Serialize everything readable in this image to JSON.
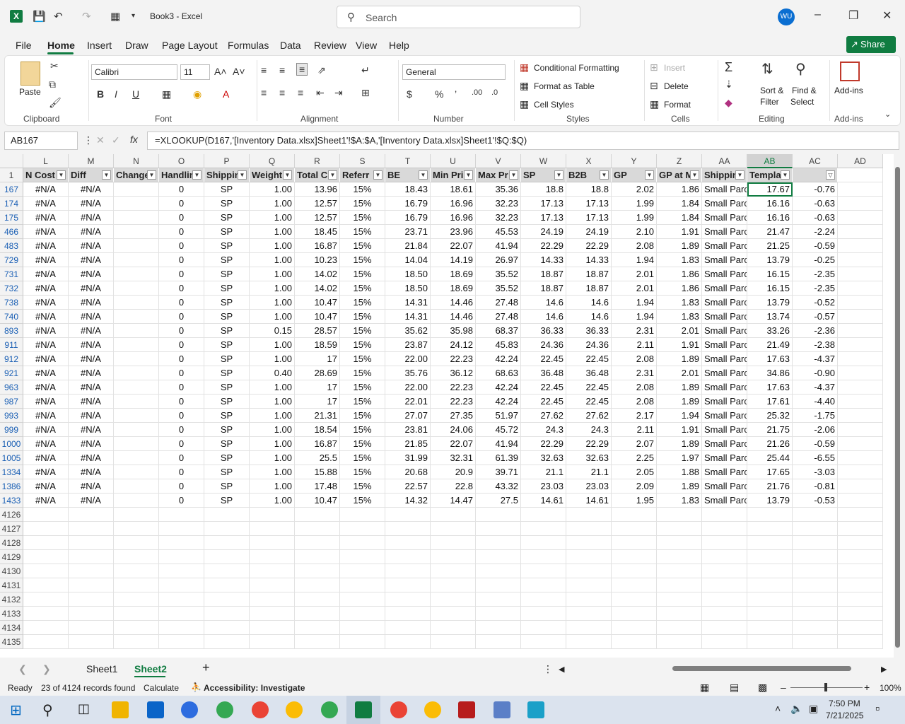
{
  "app": {
    "title": "Book3  -  Excel",
    "logo": "X"
  },
  "search": {
    "placeholder": "Search"
  },
  "user": {
    "initials": "WU"
  },
  "menu": [
    "File",
    "Home",
    "Insert",
    "Draw",
    "Page Layout",
    "Formulas",
    "Data",
    "Review",
    "View",
    "Help"
  ],
  "share_label": "Share",
  "ribbon": {
    "clipboard": {
      "paste": "Paste",
      "label": "Clipboard"
    },
    "font": {
      "name": "Calibri",
      "size": "11",
      "label": "Font"
    },
    "alignment": {
      "label": "Alignment"
    },
    "number": {
      "format": "General",
      "label": "Number"
    },
    "styles": {
      "conditional": "Conditional Formatting",
      "table": "Format as Table",
      "cell": "Cell Styles",
      "label": "Styles"
    },
    "cells": {
      "insert": "Insert",
      "delete": "Delete",
      "format": "Format",
      "label": "Cells"
    },
    "editing": {
      "sort1": "Sort &",
      "sort2": "Filter",
      "find1": "Find &",
      "find2": "Select",
      "label": "Editing"
    },
    "addins": {
      "btn": "Add-ins",
      "label": "Add-ins"
    }
  },
  "formula_bar": {
    "name_box": "AB167",
    "formula": "=XLOOKUP(D167,'[Inventory Data.xlsx]Sheet1'!$A:$A,'[Inventory Data.xlsx]Sheet1'!$Q:$Q)"
  },
  "columns": [
    "L",
    "M",
    "N",
    "O",
    "P",
    "Q",
    "R",
    "S",
    "T",
    "U",
    "V",
    "W",
    "X",
    "Y",
    "Z",
    "AA",
    "AB",
    "AC",
    "AD"
  ],
  "headers": [
    "N Cost",
    "Diff",
    "Change",
    "Handlin",
    "Shippin",
    "Weight",
    "Total C",
    "Referr",
    "BE",
    "Min Pri",
    "Max Pr",
    "SP",
    "B2B",
    "GP",
    "GP at M",
    "Shippin",
    "Templat",
    "",
    ""
  ],
  "rows": [
    {
      "n": "167",
      "v": [
        "#N/A",
        "#N/A",
        "",
        "0",
        "SP",
        "1.00",
        "13.96",
        "15%",
        "18.43",
        "18.61",
        "35.36",
        "18.8",
        "18.8",
        "2.02",
        "1.86",
        "Small Parc",
        "17.67",
        "-0.76"
      ]
    },
    {
      "n": "174",
      "v": [
        "#N/A",
        "#N/A",
        "",
        "0",
        "SP",
        "1.00",
        "12.57",
        "15%",
        "16.79",
        "16.96",
        "32.23",
        "17.13",
        "17.13",
        "1.99",
        "1.84",
        "Small Parc",
        "16.16",
        "-0.63"
      ]
    },
    {
      "n": "175",
      "v": [
        "#N/A",
        "#N/A",
        "",
        "0",
        "SP",
        "1.00",
        "12.57",
        "15%",
        "16.79",
        "16.96",
        "32.23",
        "17.13",
        "17.13",
        "1.99",
        "1.84",
        "Small Parc",
        "16.16",
        "-0.63"
      ]
    },
    {
      "n": "466",
      "v": [
        "#N/A",
        "#N/A",
        "",
        "0",
        "SP",
        "1.00",
        "18.45",
        "15%",
        "23.71",
        "23.96",
        "45.53",
        "24.19",
        "24.19",
        "2.10",
        "1.91",
        "Small Parc",
        "21.47",
        "-2.24"
      ]
    },
    {
      "n": "483",
      "v": [
        "#N/A",
        "#N/A",
        "",
        "0",
        "SP",
        "1.00",
        "16.87",
        "15%",
        "21.84",
        "22.07",
        "41.94",
        "22.29",
        "22.29",
        "2.08",
        "1.89",
        "Small Parc",
        "21.25",
        "-0.59"
      ]
    },
    {
      "n": "729",
      "v": [
        "#N/A",
        "#N/A",
        "",
        "0",
        "SP",
        "1.00",
        "10.23",
        "15%",
        "14.04",
        "14.19",
        "26.97",
        "14.33",
        "14.33",
        "1.94",
        "1.83",
        "Small Parc",
        "13.79",
        "-0.25"
      ]
    },
    {
      "n": "731",
      "v": [
        "#N/A",
        "#N/A",
        "",
        "0",
        "SP",
        "1.00",
        "14.02",
        "15%",
        "18.50",
        "18.69",
        "35.52",
        "18.87",
        "18.87",
        "2.01",
        "1.86",
        "Small Parc",
        "16.15",
        "-2.35"
      ]
    },
    {
      "n": "732",
      "v": [
        "#N/A",
        "#N/A",
        "",
        "0",
        "SP",
        "1.00",
        "14.02",
        "15%",
        "18.50",
        "18.69",
        "35.52",
        "18.87",
        "18.87",
        "2.01",
        "1.86",
        "Small Parc",
        "16.15",
        "-2.35"
      ]
    },
    {
      "n": "738",
      "v": [
        "#N/A",
        "#N/A",
        "",
        "0",
        "SP",
        "1.00",
        "10.47",
        "15%",
        "14.31",
        "14.46",
        "27.48",
        "14.6",
        "14.6",
        "1.94",
        "1.83",
        "Small Parc",
        "13.79",
        "-0.52"
      ]
    },
    {
      "n": "740",
      "v": [
        "#N/A",
        "#N/A",
        "",
        "0",
        "SP",
        "1.00",
        "10.47",
        "15%",
        "14.31",
        "14.46",
        "27.48",
        "14.6",
        "14.6",
        "1.94",
        "1.83",
        "Small Parc",
        "13.74",
        "-0.57"
      ]
    },
    {
      "n": "893",
      "v": [
        "#N/A",
        "#N/A",
        "",
        "0",
        "SP",
        "0.15",
        "28.57",
        "15%",
        "35.62",
        "35.98",
        "68.37",
        "36.33",
        "36.33",
        "2.31",
        "2.01",
        "Small Parc",
        "33.26",
        "-2.36"
      ]
    },
    {
      "n": "911",
      "v": [
        "#N/A",
        "#N/A",
        "",
        "0",
        "SP",
        "1.00",
        "18.59",
        "15%",
        "23.87",
        "24.12",
        "45.83",
        "24.36",
        "24.36",
        "2.11",
        "1.91",
        "Small Parc",
        "21.49",
        "-2.38"
      ]
    },
    {
      "n": "912",
      "v": [
        "#N/A",
        "#N/A",
        "",
        "0",
        "SP",
        "1.00",
        "17",
        "15%",
        "22.00",
        "22.23",
        "42.24",
        "22.45",
        "22.45",
        "2.08",
        "1.89",
        "Small Parc",
        "17.63",
        "-4.37"
      ]
    },
    {
      "n": "921",
      "v": [
        "#N/A",
        "#N/A",
        "",
        "0",
        "SP",
        "0.40",
        "28.69",
        "15%",
        "35.76",
        "36.12",
        "68.63",
        "36.48",
        "36.48",
        "2.31",
        "2.01",
        "Small Parc",
        "34.86",
        "-0.90"
      ]
    },
    {
      "n": "963",
      "v": [
        "#N/A",
        "#N/A",
        "",
        "0",
        "SP",
        "1.00",
        "17",
        "15%",
        "22.00",
        "22.23",
        "42.24",
        "22.45",
        "22.45",
        "2.08",
        "1.89",
        "Small Parc",
        "17.63",
        "-4.37"
      ]
    },
    {
      "n": "987",
      "v": [
        "#N/A",
        "#N/A",
        "",
        "0",
        "SP",
        "1.00",
        "17",
        "15%",
        "22.01",
        "22.23",
        "42.24",
        "22.45",
        "22.45",
        "2.08",
        "1.89",
        "Small Parc",
        "17.61",
        "-4.40"
      ]
    },
    {
      "n": "993",
      "v": [
        "#N/A",
        "#N/A",
        "",
        "0",
        "SP",
        "1.00",
        "21.31",
        "15%",
        "27.07",
        "27.35",
        "51.97",
        "27.62",
        "27.62",
        "2.17",
        "1.94",
        "Small Parc",
        "25.32",
        "-1.75"
      ]
    },
    {
      "n": "999",
      "v": [
        "#N/A",
        "#N/A",
        "",
        "0",
        "SP",
        "1.00",
        "18.54",
        "15%",
        "23.81",
        "24.06",
        "45.72",
        "24.3",
        "24.3",
        "2.11",
        "1.91",
        "Small Parc",
        "21.75",
        "-2.06"
      ]
    },
    {
      "n": "1000",
      "v": [
        "#N/A",
        "#N/A",
        "",
        "0",
        "SP",
        "1.00",
        "16.87",
        "15%",
        "21.85",
        "22.07",
        "41.94",
        "22.29",
        "22.29",
        "2.07",
        "1.89",
        "Small Parc",
        "21.26",
        "-0.59"
      ]
    },
    {
      "n": "1005",
      "v": [
        "#N/A",
        "#N/A",
        "",
        "0",
        "SP",
        "1.00",
        "25.5",
        "15%",
        "31.99",
        "32.31",
        "61.39",
        "32.63",
        "32.63",
        "2.25",
        "1.97",
        "Small Parc",
        "25.44",
        "-6.55"
      ]
    },
    {
      "n": "1334",
      "v": [
        "#N/A",
        "#N/A",
        "",
        "0",
        "SP",
        "1.00",
        "15.88",
        "15%",
        "20.68",
        "20.9",
        "39.71",
        "21.1",
        "21.1",
        "2.05",
        "1.88",
        "Small Parc",
        "17.65",
        "-3.03"
      ]
    },
    {
      "n": "1386",
      "v": [
        "#N/A",
        "#N/A",
        "",
        "0",
        "SP",
        "1.00",
        "17.48",
        "15%",
        "22.57",
        "22.8",
        "43.32",
        "23.03",
        "23.03",
        "2.09",
        "1.89",
        "Small Parc",
        "21.76",
        "-0.81"
      ]
    },
    {
      "n": "1433",
      "v": [
        "#N/A",
        "#N/A",
        "",
        "0",
        "SP",
        "1.00",
        "10.47",
        "15%",
        "14.32",
        "14.47",
        "27.5",
        "14.61",
        "14.61",
        "1.95",
        "1.83",
        "Small Parc",
        "13.79",
        "-0.53"
      ]
    }
  ],
  "empty_rows": [
    "4126",
    "4127",
    "4128",
    "4129",
    "4130",
    "4131",
    "4132",
    "4133",
    "4134",
    "4135"
  ],
  "sheets": [
    "Sheet1",
    "Sheet2"
  ],
  "active_sheet": "Sheet2",
  "status": {
    "ready": "Ready",
    "records": "23 of 4124 records found",
    "calculate": "Calculate",
    "accessibility": "Accessibility: Investigate",
    "zoom": "100%"
  },
  "clock": {
    "time": "7:50 PM",
    "date": "7/21/2025"
  },
  "colors": {
    "accent": "#107c41",
    "header_fill": "#d9d9d9",
    "row_num": "#1a5fb4"
  }
}
